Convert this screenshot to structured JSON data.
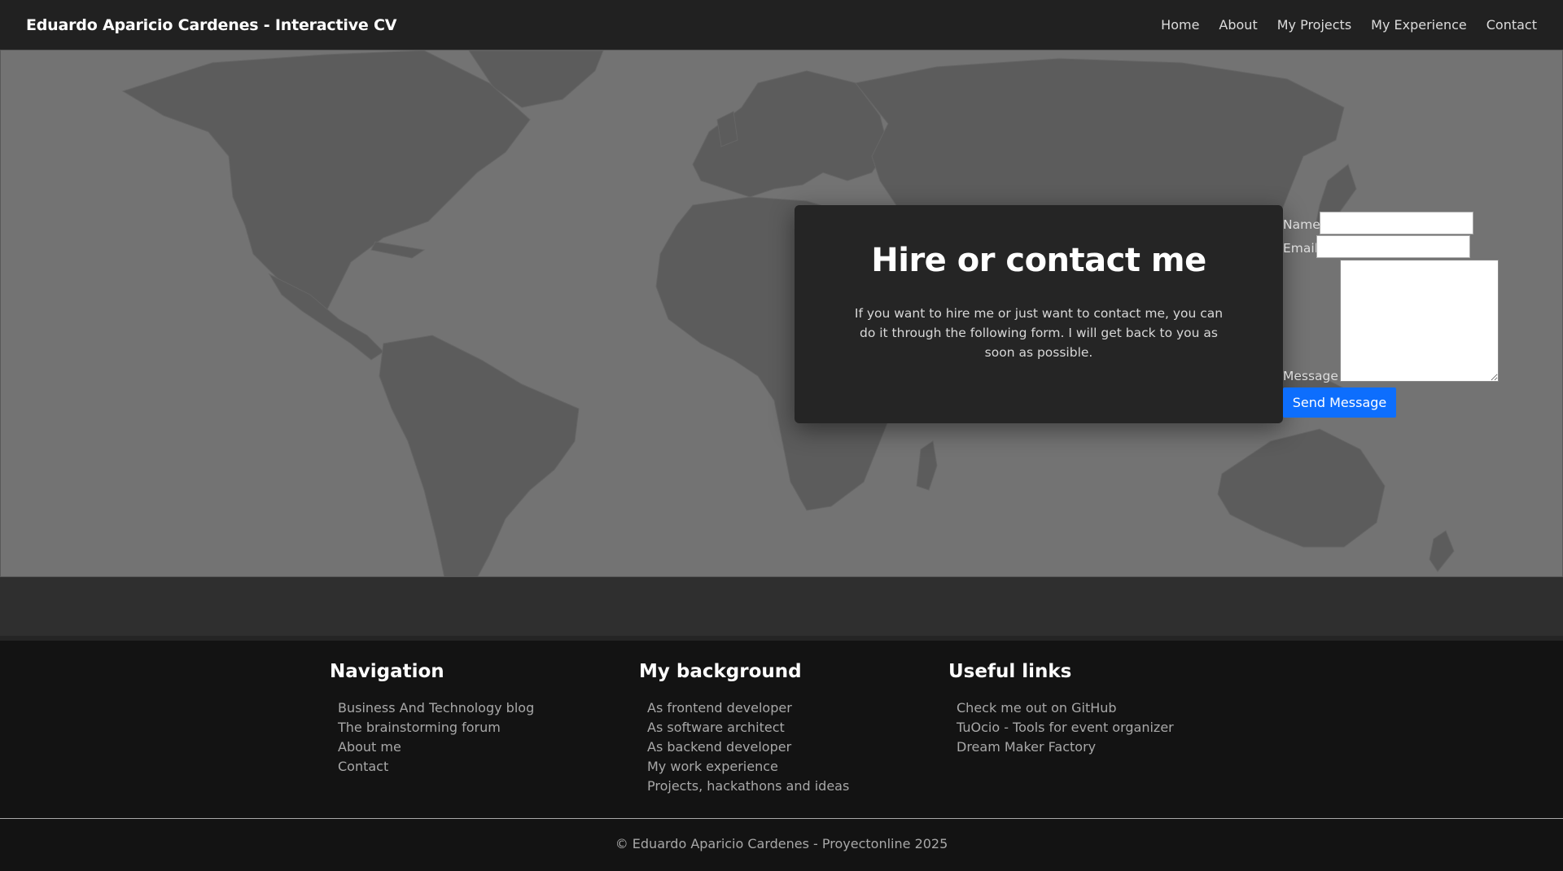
{
  "navbar": {
    "brand": "Eduardo Aparicio Cardenes - Interactive CV",
    "links": [
      "Home",
      "About",
      "My Projects",
      "My Experience",
      "Contact"
    ]
  },
  "contact": {
    "title": "Hire or contact me",
    "text": "If you want to hire me or just want to contact me, you can do it through the following form. I will get back to you as soon as possible."
  },
  "form": {
    "name_label": "Name",
    "name_value": "",
    "email_label": "Email",
    "email_value": "",
    "message_label": "Message",
    "message_value": "",
    "send_label": "Send Message",
    "button_color": "#0d6efd"
  },
  "footer": {
    "navigation": {
      "heading": "Navigation",
      "items": [
        "Business And Technology blog",
        "The brainstorming forum",
        "About me",
        "Contact"
      ]
    },
    "background": {
      "heading": "My background",
      "items": [
        "As frontend developer",
        "As software architect",
        "As backend developer",
        "My work experience",
        "Projects, hackathons and ideas"
      ]
    },
    "useful_links": {
      "heading": "Useful links",
      "items": [
        "Check me out on GitHub",
        "TuOcio - Tools for event organizer",
        "Dream Maker Factory"
      ]
    },
    "copyright": "© Eduardo Aparicio Cardenes - Proyectonline 2025"
  },
  "colors": {
    "navbar": "#212121",
    "map_background": "#737373",
    "land": "#5c5c5c",
    "card": "#252525",
    "footer": "#131313"
  }
}
